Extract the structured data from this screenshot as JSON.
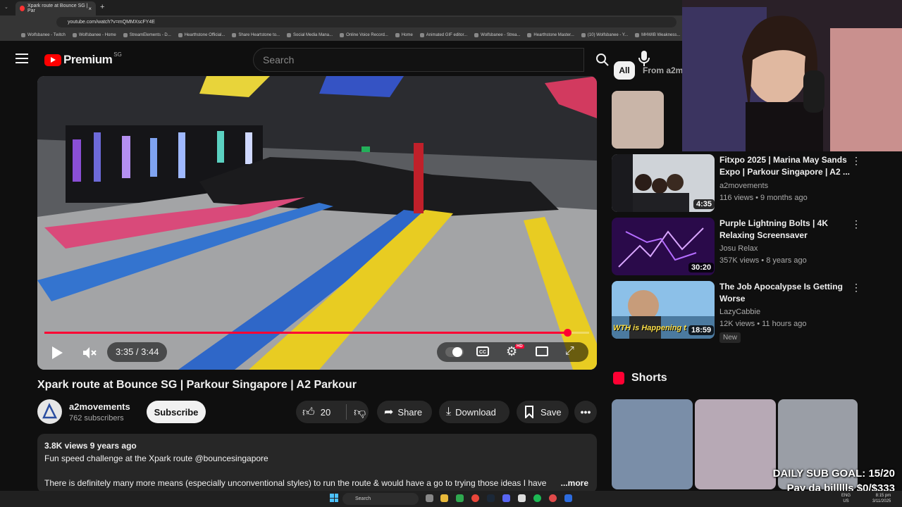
{
  "browser": {
    "tab_title": "Xpark route at Bounce SG | Par",
    "url": "youtube.com/watch?v=mQMMXscFY4E",
    "bookmarks": [
      "Wolfsbanee - Twitch",
      "Wolfsbanee - Home",
      "StreamElements - D...",
      "Hearthstone Official...",
      "Share Heartstone to...",
      "Social Media Mana...",
      "Online Voice Record...",
      "Home",
      "Animated GIF editor...",
      "Wolfsbanee - Strea...",
      "Hearthstone Master...",
      "(10) Wolfsbanee - Y...",
      "MHWIB Weakness..."
    ]
  },
  "header": {
    "logo_text": "Premium",
    "region": "SG",
    "search_placeholder": "Search"
  },
  "player": {
    "time": "3:35 / 3:44",
    "progress": 0.96,
    "hd_badge": "HD"
  },
  "video": {
    "title": "Xpark route at Bounce SG | Parkour Singapore | A2 Parkour",
    "channel": "a2movements",
    "subscribers": "762 subscribers",
    "subscribe_label": "Subscribe",
    "likes": "20",
    "share_label": "Share",
    "download_label": "Download",
    "save_label": "Save",
    "views_date": "3.8K views  9 years ago",
    "desc_line1": "Fun speed challenge at the Xpark route @bouncesingapore",
    "desc_line2": "There is definitely many more means (especially unconventional styles) to run the route & would have a go to trying those ideas I have",
    "more_label": "...more"
  },
  "sidebar": {
    "chips": [
      "All",
      "From a2m"
    ],
    "videos": [
      {
        "title": "Fitxpo 2025 | Marina May Sands Expo | Parkour Singapore | A2 ...",
        "channel": "a2movements",
        "meta": "116 views • 9 months ago",
        "duration": "4:35"
      },
      {
        "title": "Purple Lightning Bolts | 4K Relaxing Screensaver",
        "channel": "Josu Relax",
        "meta": "357K views • 8 years ago",
        "duration": "30:20"
      },
      {
        "title": "The Job Apocalypse Is Getting Worse",
        "channel": "LazyCabbie",
        "meta": "12K views • 11 hours ago",
        "duration": "18:59",
        "badge": "New",
        "thumb_caption": "WTH is Happening t"
      }
    ],
    "shorts_label": "Shorts"
  },
  "overlay": {
    "goal_line1": "DAILY SUB GOAL: 15/20",
    "goal_line2": "Pay da billllls $0/$333"
  },
  "taskbar": {
    "search_label": "Search",
    "lang": "ENG",
    "region": "US",
    "time": "8:15 pm",
    "date": "3/11/2025"
  },
  "colors": {
    "accent": "#ff0033",
    "background": "#0f0f0f",
    "surface": "#272727"
  }
}
